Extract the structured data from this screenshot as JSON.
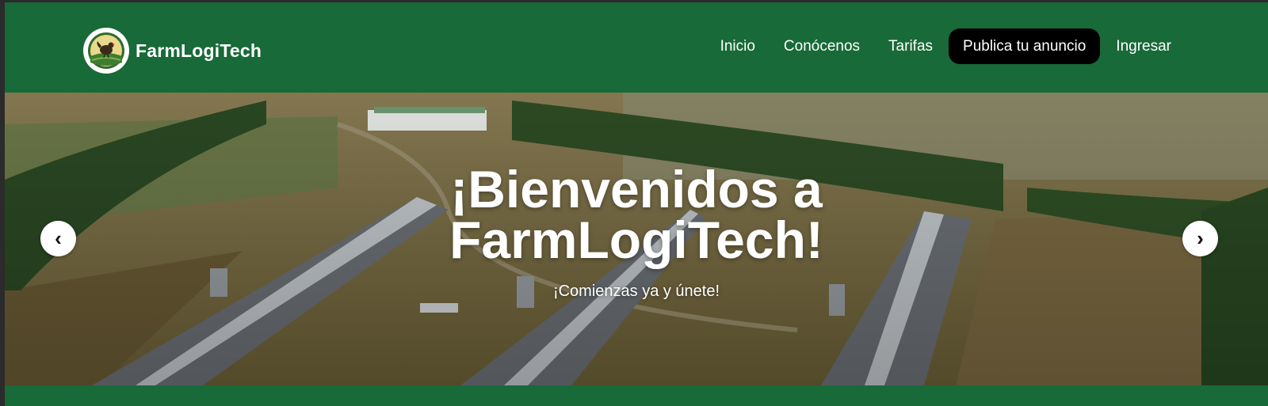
{
  "brand": {
    "name": "FarmLogiTech",
    "logo_icon": "farm-hen-logo-icon"
  },
  "nav": {
    "items": [
      {
        "label": "Inicio"
      },
      {
        "label": "Conócenos"
      },
      {
        "label": "Tarifas"
      },
      {
        "label": "Publica tu anuncio",
        "highlight": true
      },
      {
        "label": "Ingresar"
      }
    ]
  },
  "hero": {
    "title_line1": "¡Bienvenidos a",
    "title_line2": "FarmLogiTech!",
    "subtitle": "¡Comienzas ya y únete!",
    "prev_label": "‹",
    "next_label": "›"
  },
  "colors": {
    "brand_green": "#186a38",
    "cta_black": "#000000",
    "text_white": "#ffffff"
  }
}
